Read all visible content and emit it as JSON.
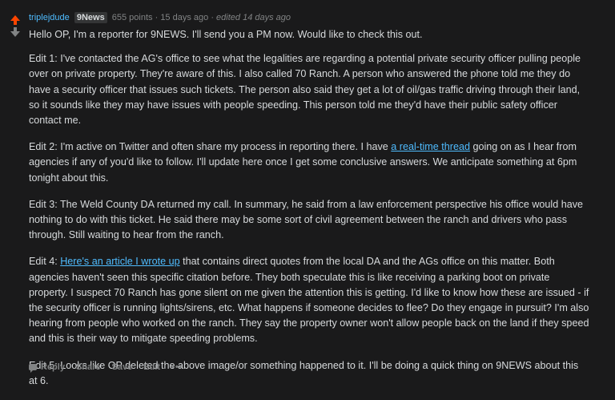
{
  "comment": {
    "author": "triplejdude",
    "flair": "9News",
    "points": "655 points",
    "time": "15 days ago",
    "edited": "edited 14 days ago",
    "separator": "·",
    "p1": "Hello OP, I'm a reporter for 9NEWS. I'll send you a PM now. Would like to check this out.",
    "p2": "Edit 1: I've contacted the AG's office to see what the legalities are regarding a potential private security officer pulling people over on private property. They're aware of this. I also called 70 Ranch. A person who answered the phone told me they do have a security officer that issues such tickets. The person also said they get a lot of oil/gas traffic driving through their land, so it sounds like they may have issues with people speeding. This person told me they'd have their public safety officer contact me.",
    "p3_before": "Edit 2: I'm active on Twitter and often share my process in reporting there. I have ",
    "p3_link": "a real-time thread",
    "p3_after": " going on as I hear from agencies if any of you'd like to follow. I'll update here once I get some conclusive answers. We anticipate something at 6pm tonight about this.",
    "p4": "Edit 3: The Weld County DA returned my call. In summary, he said from a law enforcement perspective his office would have nothing to do with this ticket. He said there may be some sort of civil agreement between the ranch and drivers who pass through. Still waiting to hear from the ranch.",
    "p5_before": "Edit 4: ",
    "p5_link": "Here's an article I wrote up",
    "p5_after": " that contains direct quotes from the local DA and the AGs office on this matter. Both agencies haven't seen this specific citation before. They both speculate this is like receiving a parking boot on private property. I suspect 70 Ranch has gone silent on me given the attention this is getting. I'd like to know how these are issued - if the security officer is running lights/sirens, etc. What happens if someone decides to flee? Do they engage in pursuit? I'm also hearing from people who worked on the ranch. They say the property owner won't allow people back on the land if they speed and this is their way to mitigate speeding problems.",
    "p6": "Edit 5: Looks like OP deleted the above image/or something happened to it. I'll be doing a quick thing on 9NEWS about this at 6."
  },
  "actions": {
    "reply": "Reply",
    "share": "Share",
    "save": "Save",
    "edit": "Edit",
    "more": "•••"
  },
  "colors": {
    "upvote": "#ff4500",
    "link": "#4fbcff",
    "background": "#1a1a1b"
  }
}
